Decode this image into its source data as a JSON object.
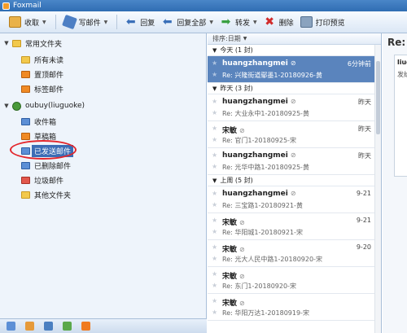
{
  "window": {
    "title": "Foxmail"
  },
  "toolbar": {
    "receive": "收取",
    "write": "写邮件",
    "reply": "回复",
    "reply_all": "回复全部",
    "forward": "转发",
    "delete": "删除",
    "print_preview": "打印预览"
  },
  "folders": {
    "common": {
      "label": "常用文件夹",
      "items": [
        "所有未读",
        "置顶邮件",
        "标签邮件"
      ]
    },
    "account": {
      "label": "oubuy(liuguoke)",
      "items": [
        "收件箱",
        "草稿箱",
        "已发送邮件",
        "已删除邮件",
        "垃圾邮件",
        "其他文件夹"
      ],
      "selected": "已发送邮件"
    }
  },
  "list": {
    "sort_label": "排序:日期",
    "groups": [
      {
        "label": "今天 (1 封)",
        "messages": [
          {
            "sender": "huangzhangmei",
            "time": "6分钟前",
            "subject": "Re: 兴隆街道鄢墨1-20180926-黄",
            "selected": true,
            "attachment": true
          }
        ]
      },
      {
        "label": "昨天 (3 封)",
        "messages": [
          {
            "sender": "huangzhangmei",
            "time": "昨天",
            "subject": "Re: 大业永中1-20180925-黄",
            "selected": false,
            "attachment": true
          },
          {
            "sender": "宋敏",
            "time": "昨天",
            "subject": "Re: 官门1-20180925-宋",
            "selected": false,
            "attachment": true
          },
          {
            "sender": "huangzhangmei",
            "time": "昨天",
            "subject": "Re: 光华中路1-20180925-黄",
            "selected": false,
            "attachment": true
          }
        ]
      },
      {
        "label": "上周 (5 封)",
        "messages": [
          {
            "sender": "huangzhangmei",
            "time": "9-21",
            "subject": "Re: 三宝路1-20180921-黄",
            "selected": false,
            "attachment": true
          },
          {
            "sender": "宋敏",
            "time": "9-21",
            "subject": "Re: 华阳城1-20180921-宋",
            "selected": false,
            "attachment": true
          },
          {
            "sender": "宋敏",
            "time": "9-20",
            "subject": "Re: 光大人民中路1-20180920-宋",
            "selected": false,
            "attachment": true
          },
          {
            "sender": "宋敏",
            "time": "",
            "subject": "Re: 东门1-20180920-宋",
            "selected": false,
            "attachment": true
          },
          {
            "sender": "宋敏",
            "time": "",
            "subject": "Re: 华阳万达1-20180919-宋",
            "selected": false,
            "attachment": true
          }
        ]
      }
    ]
  },
  "preview": {
    "title": "Re:",
    "from": "liuguoke",
    "meta": "发给"
  },
  "colors": {
    "accent": "#3c6db5",
    "annotation": "#e3262c",
    "selected_row": "#5a84bd"
  }
}
